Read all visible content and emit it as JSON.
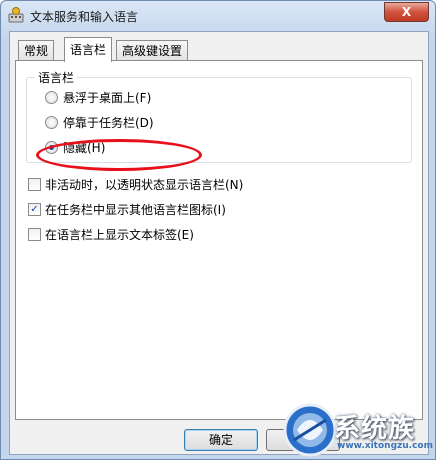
{
  "window": {
    "title": "文本服务和输入语言",
    "close_glyph": "X"
  },
  "tabs": [
    {
      "label": "常规",
      "selected": false
    },
    {
      "label": "语言栏",
      "selected": true
    },
    {
      "label": "高级键设置",
      "selected": false
    }
  ],
  "language_bar": {
    "group_title": "语言栏",
    "options": [
      {
        "label": "悬浮于桌面上(F)",
        "checked": false
      },
      {
        "label": "停靠于任务栏(D)",
        "checked": false
      },
      {
        "label": "隐藏(H)",
        "checked": true
      }
    ]
  },
  "checkboxes": [
    {
      "label": "非活动时，以透明状态显示语言栏(N)",
      "checked": false
    },
    {
      "label": "在任务栏中显示其他语言栏图标(I)",
      "checked": true
    },
    {
      "label": "在语言栏上显示文本标签(E)",
      "checked": false
    }
  ],
  "buttons": {
    "ok": "确定"
  },
  "watermark": {
    "text": "系统族",
    "url": "www.xitongzu.com"
  },
  "colors": {
    "highlight_oval": "#e8101a",
    "accent": "#1e3f9a"
  }
}
